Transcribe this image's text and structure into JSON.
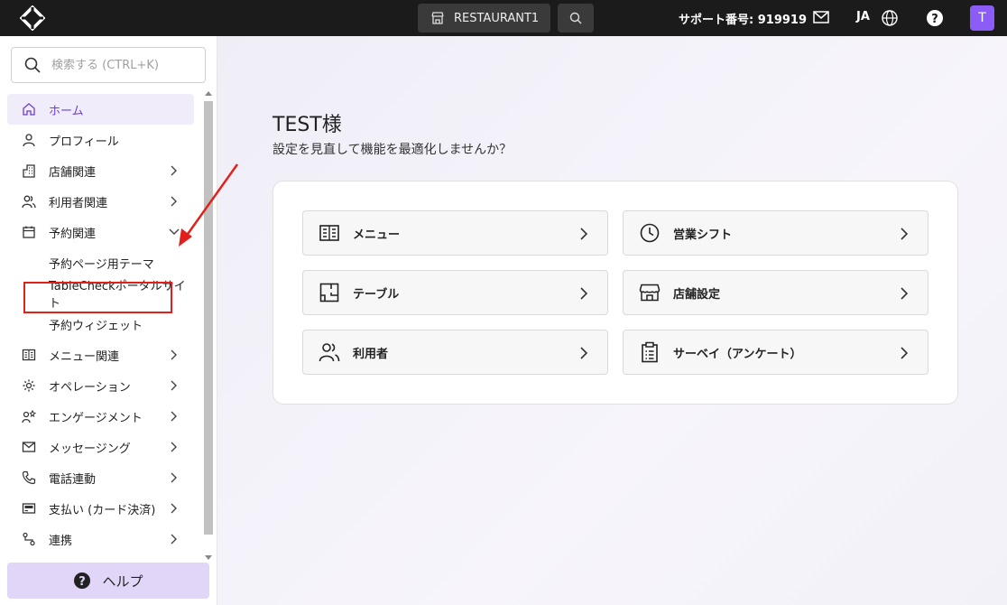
{
  "topbar": {
    "restaurant": "RESTAURANT1",
    "support": "サポート番号: 919919",
    "lang": "JA",
    "avatar": "T"
  },
  "sidebar": {
    "search_placeholder": "検索する (CTRL+K)",
    "items": [
      {
        "label": "ホーム",
        "icon": "home-icon"
      },
      {
        "label": "プロフィール",
        "icon": "user-icon"
      },
      {
        "label": "店舗関連",
        "icon": "building-icon"
      },
      {
        "label": "利用者関連",
        "icon": "users-icon"
      },
      {
        "label": "予約関連",
        "icon": "calendar-icon"
      },
      {
        "label": "予約ページ用テーマ"
      },
      {
        "label": "TableCheckポータルサイト"
      },
      {
        "label": "予約ウィジェット"
      },
      {
        "label": "メニュー関連",
        "icon": "menu-book-icon"
      },
      {
        "label": "オペレーション",
        "icon": "gear-icon"
      },
      {
        "label": "エンゲージメント",
        "icon": "engagement-icon"
      },
      {
        "label": "メッセージング",
        "icon": "mail-icon"
      },
      {
        "label": "電話連動",
        "icon": "phone-icon"
      },
      {
        "label": "支払い (カード決済)",
        "icon": "payment-icon"
      },
      {
        "label": "連携",
        "icon": "integration-icon"
      }
    ],
    "help_label": "ヘルプ"
  },
  "main": {
    "greeting": "TEST様",
    "subtitle": "設定を見直して機能を最適化しませんか？",
    "tiles": [
      {
        "label": "メニュー",
        "icon": "menu-book-icon"
      },
      {
        "label": "営業シフト",
        "icon": "clock-icon"
      },
      {
        "label": "テーブル",
        "icon": "table-icon"
      },
      {
        "label": "店舗設定",
        "icon": "store-icon"
      },
      {
        "label": "利用者",
        "icon": "users-icon"
      },
      {
        "label": "サーベイ（アンケート）",
        "icon": "clipboard-icon"
      }
    ]
  },
  "colors": {
    "accent": "#6d3fd6",
    "avatar_bg": "#8b5cf6",
    "highlight": "#e0201b",
    "help_bg": "#e2d6f8"
  }
}
